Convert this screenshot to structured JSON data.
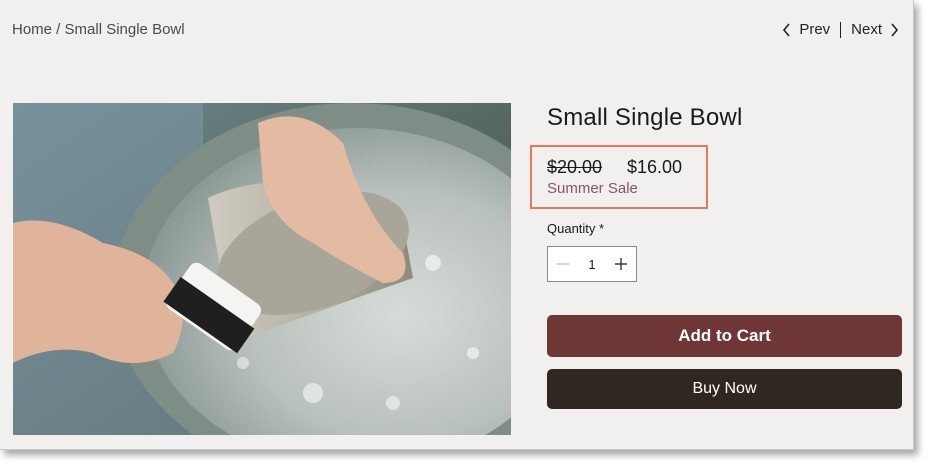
{
  "breadcrumb": {
    "home": "Home",
    "separator": " / ",
    "current": "Small Single Bowl"
  },
  "nav": {
    "prev_label": "Prev",
    "next_label": "Next"
  },
  "product": {
    "title": "Small Single Bowl",
    "original_price": "$20.00",
    "sale_price": "$16.00",
    "sale_label": "Summer Sale",
    "image_icon": "product-photo"
  },
  "quantity": {
    "label": "Quantity *",
    "value": "1"
  },
  "actions": {
    "add_to_cart": "Add to Cart",
    "buy_now": "Buy Now"
  },
  "colors": {
    "add_to_cart_bg": "#6f3636",
    "buy_now_bg": "#302820",
    "highlight_border": "#e8785a",
    "sale_text": "#8a5560"
  }
}
